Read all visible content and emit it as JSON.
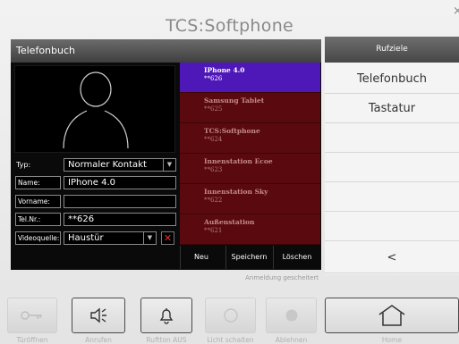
{
  "app": {
    "title": "TCS:Softphone",
    "close_glyph": "×"
  },
  "phonebook": {
    "header": "Telefonbuch",
    "form": {
      "type_label": "Typ:",
      "type_value": "Normaler Kontakt",
      "name_label": "Name:",
      "name_value": "IPhone 4.0",
      "firstname_label": "Vorname:",
      "firstname_value": "",
      "phone_label": "Tel.Nr.:",
      "phone_value": "**626",
      "video_label": "Videoquelle:",
      "video_value": "Haustür",
      "dropdown_glyph": "▼",
      "remove_glyph": "✕"
    },
    "contacts": [
      {
        "name": "IPhone 4.0",
        "number": "**626"
      },
      {
        "name": "Samsung Tablet",
        "number": "**625"
      },
      {
        "name": "TCS:Softphone",
        "number": "**624"
      },
      {
        "name": "Innenstation Ecoe",
        "number": "**623"
      },
      {
        "name": "Innenstation Sky",
        "number": "**622"
      },
      {
        "name": "Außenstation",
        "number": "**621"
      }
    ],
    "selected_index": 0,
    "buttons": {
      "new": "Neu",
      "save": "Speichern",
      "delete": "Löschen"
    },
    "status": "Anmeldung gescheitert"
  },
  "right_menu": {
    "header": "Rufziele",
    "items": [
      "Telefonbuch",
      "Tastatur"
    ],
    "back": "<"
  },
  "toolbar": {
    "items": [
      {
        "label": "Türöffnen",
        "icon": "key-icon"
      },
      {
        "label": "Anrufen",
        "icon": "speaker-icon"
      },
      {
        "label": "Ruftton AUS",
        "icon": "bell-icon"
      },
      {
        "label": "Licht schalten",
        "icon": "light-icon"
      },
      {
        "label": "Ablehnen",
        "icon": "hangup-icon"
      },
      {
        "label": "Home",
        "icon": "home-icon"
      }
    ]
  },
  "colors": {
    "selected_contact": "#4e17b8",
    "contact_bg": "#5a0a0e",
    "remove_red": "#e53030"
  }
}
